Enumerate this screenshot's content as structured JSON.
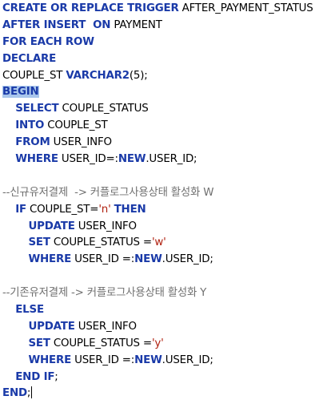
{
  "lines": [
    {
      "indent": "",
      "tokens": [
        {
          "t": "kw",
          "v": "CREATE OR REPLACE TRIGGER"
        },
        {
          "t": "id",
          "v": " AFTER_PAYMENT_STATUS"
        }
      ]
    },
    {
      "indent": "",
      "tokens": [
        {
          "t": "kw",
          "v": "AFTER INSERT  ON"
        },
        {
          "t": "id",
          "v": " PAYMENT"
        }
      ]
    },
    {
      "indent": "",
      "tokens": [
        {
          "t": "kw",
          "v": "FOR EACH ROW"
        }
      ]
    },
    {
      "indent": "",
      "tokens": [
        {
          "t": "kw",
          "v": "DECLARE"
        }
      ]
    },
    {
      "indent": "",
      "tokens": [
        {
          "t": "id",
          "v": "COUPLE_ST "
        },
        {
          "t": "kw",
          "v": "VARCHAR2"
        },
        {
          "t": "id",
          "v": "(5);"
        }
      ]
    },
    {
      "indent": "",
      "tokens": [
        {
          "t": "kw-sel",
          "v": "BEGIN"
        }
      ]
    },
    {
      "indent": "    ",
      "tokens": [
        {
          "t": "kw",
          "v": "SELECT"
        },
        {
          "t": "id",
          "v": " COUPLE_STATUS"
        }
      ]
    },
    {
      "indent": "    ",
      "tokens": [
        {
          "t": "kw",
          "v": "INTO"
        },
        {
          "t": "id",
          "v": " COUPLE_ST"
        }
      ]
    },
    {
      "indent": "    ",
      "tokens": [
        {
          "t": "kw",
          "v": "FROM"
        },
        {
          "t": "id",
          "v": " USER_INFO"
        }
      ]
    },
    {
      "indent": "    ",
      "tokens": [
        {
          "t": "kw",
          "v": "WHERE"
        },
        {
          "t": "id",
          "v": " USER_ID=:"
        },
        {
          "t": "kw",
          "v": "NEW"
        },
        {
          "t": "id",
          "v": ".USER_ID;"
        }
      ]
    },
    {
      "indent": "",
      "tokens": []
    },
    {
      "indent": "",
      "tokens": [
        {
          "t": "cmt",
          "v": "--신규유저결제  -> 커플로그사용상태 활성화 W"
        }
      ]
    },
    {
      "indent": "    ",
      "tokens": [
        {
          "t": "kw",
          "v": "IF"
        },
        {
          "t": "id",
          "v": " COUPLE_ST="
        },
        {
          "t": "str",
          "v": "'n'"
        },
        {
          "t": "id",
          "v": " "
        },
        {
          "t": "kw",
          "v": "THEN"
        }
      ]
    },
    {
      "indent": "        ",
      "tokens": [
        {
          "t": "kw",
          "v": "UPDATE"
        },
        {
          "t": "id",
          "v": " USER_INFO"
        }
      ]
    },
    {
      "indent": "        ",
      "tokens": [
        {
          "t": "kw",
          "v": "SET"
        },
        {
          "t": "id",
          "v": " COUPLE_STATUS ="
        },
        {
          "t": "str",
          "v": "'w'"
        }
      ]
    },
    {
      "indent": "        ",
      "tokens": [
        {
          "t": "kw",
          "v": "WHERE"
        },
        {
          "t": "id",
          "v": " USER_ID =:"
        },
        {
          "t": "kw",
          "v": "NEW"
        },
        {
          "t": "id",
          "v": ".USER_ID;"
        }
      ]
    },
    {
      "indent": "",
      "tokens": []
    },
    {
      "indent": "",
      "tokens": [
        {
          "t": "cmt",
          "v": "--기존유저결제 -> 커플로그사용상태 활성화 Y"
        }
      ]
    },
    {
      "indent": "    ",
      "tokens": [
        {
          "t": "kw",
          "v": "ELSE"
        }
      ]
    },
    {
      "indent": "        ",
      "tokens": [
        {
          "t": "kw",
          "v": "UPDATE"
        },
        {
          "t": "id",
          "v": " USER_INFO"
        }
      ]
    },
    {
      "indent": "        ",
      "tokens": [
        {
          "t": "kw",
          "v": "SET"
        },
        {
          "t": "id",
          "v": " COUPLE_STATUS ="
        },
        {
          "t": "str",
          "v": "'y'"
        }
      ]
    },
    {
      "indent": "        ",
      "tokens": [
        {
          "t": "kw",
          "v": "WHERE"
        },
        {
          "t": "id",
          "v": " USER_ID =:"
        },
        {
          "t": "kw",
          "v": "NEW"
        },
        {
          "t": "id",
          "v": ".USER_ID;"
        }
      ]
    },
    {
      "indent": "    ",
      "tokens": [
        {
          "t": "kw",
          "v": "END IF"
        },
        {
          "t": "id",
          "v": ";"
        }
      ]
    },
    {
      "indent": "",
      "tokens": [
        {
          "t": "kw",
          "v": "END"
        },
        {
          "t": "id",
          "v": ";"
        },
        {
          "t": "caret",
          "v": ""
        }
      ]
    }
  ],
  "colors": {
    "keyword": "#1a3aa8",
    "identifier": "#000000",
    "string": "#b0200f",
    "comment": "#707070",
    "selection": "#a9c6ec"
  }
}
